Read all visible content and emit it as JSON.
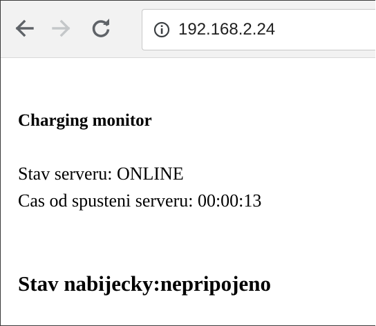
{
  "browser": {
    "url": "192.168.2.24",
    "icons": {
      "back": "back-arrow-icon",
      "forward": "forward-arrow-icon",
      "reload": "reload-icon",
      "info": "info-icon"
    }
  },
  "page": {
    "heading": "Charging monitor",
    "server_status": "Stav serveru: ONLINE",
    "uptime": "Cas od spusteni serveru: 00:00:13",
    "charger_status": "Stav nabijecky:nepripojeno"
  }
}
